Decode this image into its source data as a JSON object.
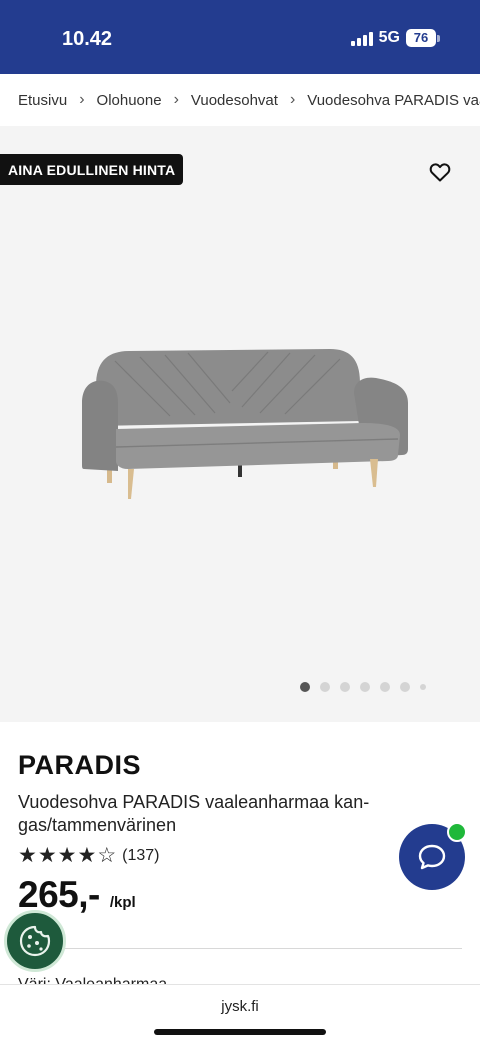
{
  "status_bar": {
    "time": "10.42",
    "network": "5G",
    "battery": "76"
  },
  "breadcrumb": {
    "items": [
      "Etusivu",
      "Olohuone",
      "Vuodesohvat",
      "Vuodesohva PARADIS vaaleanharmaa"
    ],
    "separator": "›"
  },
  "gallery": {
    "badge": "AINA EDULLINEN HINTA",
    "favorite_icon": "heart-icon",
    "image_subject": "grey sofa bed with wooden legs",
    "image_count": 7,
    "active_image": 1
  },
  "product": {
    "brand": "PARADIS",
    "description": "Vuodesohva PARADIS vaaleanharmaa kan-gas/tammenvärinen",
    "rating_stars": 4,
    "rating_max": 5,
    "review_count": "(137)",
    "price": "265,-",
    "unit": "/kpl",
    "color_label": "Väri: Vaaleanharmaa"
  },
  "chat": {
    "icon": "chat-bubble-icon",
    "notification_color": "#1fb83a"
  },
  "cookie": {
    "icon": "cookie-icon"
  },
  "browser": {
    "url": "jysk.fi"
  },
  "colors": {
    "brand_blue": "#233c8f",
    "badge_bg": "#111111",
    "gallery_bg": "#f4f4f4"
  }
}
